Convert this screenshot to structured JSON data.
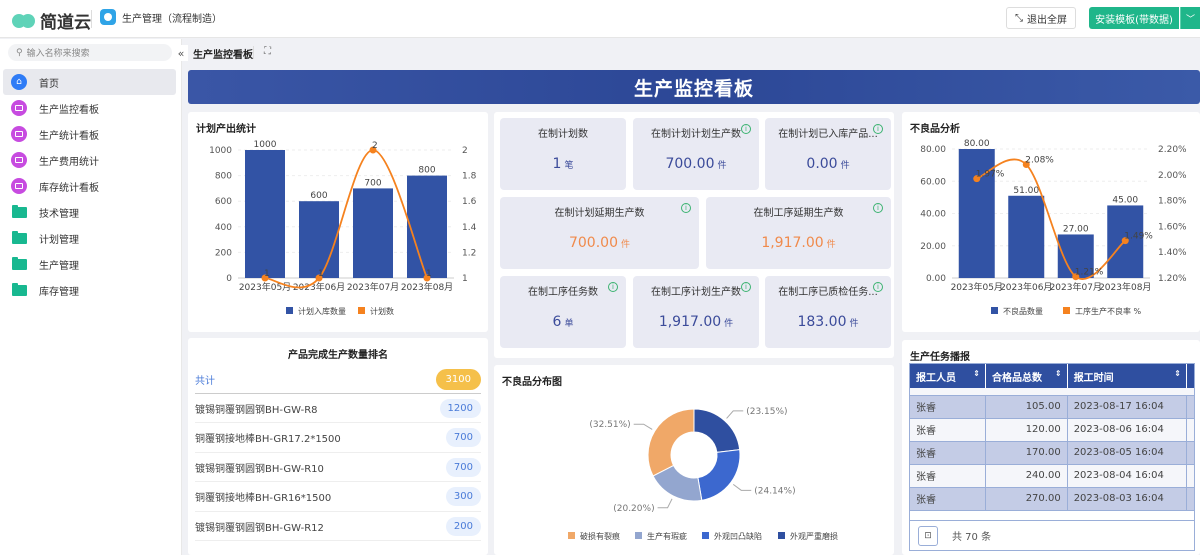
{
  "header": {
    "brand": "简道云",
    "app_name": "生产管理（流程制造）",
    "exit_fullscreen": "退出全屏",
    "install_template": "安装模板(带数据)"
  },
  "sidebar": {
    "search_placeholder": "输入名称来搜索",
    "items": [
      {
        "label": "首页",
        "icon": "home-icon",
        "active": true
      },
      {
        "label": "生产监控看板",
        "icon": "dashboard-icon"
      },
      {
        "label": "生产统计看板",
        "icon": "dashboard-icon"
      },
      {
        "label": "生产费用统计",
        "icon": "dashboard-icon"
      },
      {
        "label": "库存统计看板",
        "icon": "dashboard-icon"
      },
      {
        "label": "技术管理",
        "icon": "folder-icon"
      },
      {
        "label": "计划管理",
        "icon": "folder-icon"
      },
      {
        "label": "生产管理",
        "icon": "folder-icon"
      },
      {
        "label": "库存管理",
        "icon": "folder-icon"
      }
    ]
  },
  "tab": {
    "title": "生产监控看板"
  },
  "banner": {
    "title": "生产监控看板"
  },
  "stats": [
    {
      "label": "在制计划数",
      "value": "1",
      "unit": "笔",
      "info": false
    },
    {
      "label": "在制计划计划生产数",
      "value": "700.00",
      "unit": "件",
      "info": true
    },
    {
      "label": "在制计划已入库产品...",
      "value": "0.00",
      "unit": "件",
      "info": true
    },
    {
      "label": "在制计划延期生产数",
      "value": "700.00",
      "unit": "件",
      "info": true,
      "warn": true
    },
    {
      "label": "在制工序延期生产数",
      "value": "1,917.00",
      "unit": "件",
      "info": true,
      "warn": true
    },
    {
      "label": "在制工序任务数",
      "value": "6",
      "unit": "单",
      "info": true
    },
    {
      "label": "在制工序计划生产数",
      "value": "1,917.00",
      "unit": "件",
      "info": true
    },
    {
      "label": "在制工序已质检任务...",
      "value": "183.00",
      "unit": "件",
      "info": true
    }
  ],
  "ranking": {
    "title": "产品完成生产数量排名",
    "total_label": "共计",
    "total": "3100",
    "rows": [
      {
        "name": "镀锡铜覆钢圆钢BH-GW-R8",
        "value": "1200"
      },
      {
        "name": "铜覆钢接地棒BH-GR17.2*1500",
        "value": "700"
      },
      {
        "name": "镀锡铜覆钢圆钢BH-GW-R10",
        "value": "700"
      },
      {
        "name": "铜覆钢接地棒BH-GR16*1500",
        "value": "300"
      },
      {
        "name": "镀锡铜覆钢圆钢BH-GW-R12",
        "value": "200"
      }
    ]
  },
  "tasks": {
    "title": "生产任务播报",
    "columns": [
      "报工人员",
      "合格品总数",
      "报工时间"
    ],
    "rows": [
      [
        "张睿",
        "105.00",
        "2023-08-17 16:04"
      ],
      [
        "张睿",
        "120.00",
        "2023-08-06 16:04"
      ],
      [
        "张睿",
        "170.00",
        "2023-08-05 16:04"
      ],
      [
        "张睿",
        "240.00",
        "2023-08-04 16:04"
      ],
      [
        "张睿",
        "270.00",
        "2023-08-03 16:04"
      ]
    ],
    "total_text": "共 70 条"
  },
  "colors": {
    "bar": "#3253a5",
    "line": "#f5821f",
    "accent": "#1fb68a"
  },
  "chart_data": [
    {
      "id": "plan",
      "type": "bar+line",
      "title": "计划产出统计",
      "categories": [
        "2023年05月",
        "2023年06月",
        "2023年07月",
        "2023年08月"
      ],
      "series": [
        {
          "name": "计划入库数量",
          "type": "bar",
          "values": [
            1000,
            600,
            700,
            800
          ],
          "labels": [
            "1000",
            "600",
            "700",
            "800"
          ]
        },
        {
          "name": "计划数",
          "type": "line",
          "axis": "right",
          "values": [
            1,
            1,
            2,
            1
          ],
          "labels": [
            "1",
            "1",
            "2",
            "1"
          ]
        }
      ],
      "ylim": [
        0,
        1000
      ],
      "yticks": [
        "0",
        "200",
        "400",
        "600",
        "800",
        "1000"
      ],
      "y2lim": [
        1,
        2
      ],
      "y2ticks": [
        "1",
        "1.2",
        "1.4",
        "1.6",
        "1.8",
        "2"
      ],
      "legend": "bottom"
    },
    {
      "id": "defect",
      "type": "bar+line",
      "title": "不良品分析",
      "categories": [
        "2023年05月",
        "2023年06月",
        "2023年07月",
        "2023年08月"
      ],
      "series": [
        {
          "name": "不良品数量",
          "type": "bar",
          "values": [
            80,
            51,
            27,
            45
          ],
          "labels": [
            "80.00",
            "51.00",
            "27.00",
            "45.00"
          ]
        },
        {
          "name": "工序生产不良率 %",
          "type": "line",
          "axis": "right",
          "values": [
            1.97,
            2.08,
            1.21,
            1.49
          ],
          "labels": [
            "1.97%",
            "2.08%",
            "1.21%",
            "1.49%"
          ]
        }
      ],
      "ylim": [
        0,
        80
      ],
      "yticks": [
        "0.00",
        "20.00",
        "40.00",
        "60.00",
        "80.00"
      ],
      "y2lim": [
        1.2,
        2.2
      ],
      "y2ticks": [
        "1.20%",
        "1.40%",
        "1.60%",
        "1.80%",
        "2.00%",
        "2.20%"
      ],
      "legend": "bottom"
    },
    {
      "id": "dist",
      "type": "pie",
      "title": "不良品分布图",
      "slices": [
        {
          "name": "外观严重磨损",
          "value": 23.15,
          "label": "(23.15%)",
          "color": "#2f4fa0"
        },
        {
          "name": "外观凹凸缺陷",
          "value": 24.14,
          "label": "(24.14%)",
          "color": "#3c68cf"
        },
        {
          "name": "生产有瑕疵",
          "value": 20.2,
          "label": "(20.20%)",
          "color": "#93a6cf"
        },
        {
          "name": "破损有裂痕",
          "value": 32.51,
          "label": "(32.51%)",
          "color": "#f0a868"
        }
      ],
      "legend_order": [
        "破损有裂痕",
        "生产有瑕疵",
        "外观凹凸缺陷",
        "外观严重磨损"
      ],
      "legend": "bottom"
    }
  ]
}
